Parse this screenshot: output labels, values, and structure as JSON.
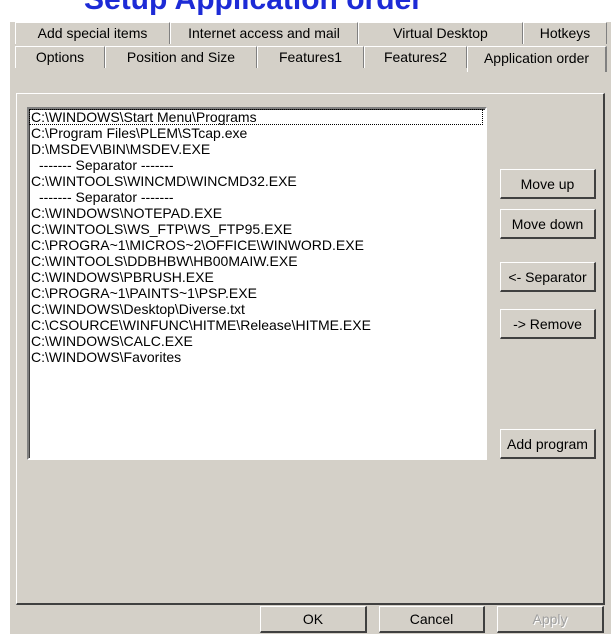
{
  "page_title": "Setup Application order",
  "tabs": {
    "row1": [
      "Add special items",
      "Internet access and mail",
      "Virtual Desktop",
      "Hotkeys"
    ],
    "row2": [
      "Options",
      "Position and Size",
      "Features1",
      "Features2",
      "Application order"
    ],
    "active": "Application order"
  },
  "list": {
    "items": [
      "C:\\WINDOWS\\Start Menu\\Programs",
      "C:\\Program Files\\PLEM\\STcap.exe",
      "D:\\MSDEV\\BIN\\MSDEV.EXE",
      "------- Separator -------",
      "C:\\WINTOOLS\\WINCMD\\WINCMD32.EXE",
      "------- Separator -------",
      "C:\\WINDOWS\\NOTEPAD.EXE",
      "C:\\WINTOOLS\\WS_FTP\\WS_FTP95.EXE",
      "C:\\PROGRA~1\\MICROS~2\\OFFICE\\WINWORD.EXE",
      "C:\\WINTOOLS\\DDBHBW\\HB00MAIW.EXE",
      "C:\\WINDOWS\\PBRUSH.EXE",
      "C:\\PROGRA~1\\PAINTS~1\\PSP.EXE",
      "C:\\WINDOWS\\Desktop\\Diverse.txt",
      "C:\\CSOURCE\\WINFUNC\\HITME\\Release\\HITME.EXE",
      "C:\\WINDOWS\\CALC.EXE",
      "C:\\WINDOWS\\Favorites"
    ]
  },
  "buttons": {
    "move_up": "Move up",
    "move_down": "Move down",
    "separator": "<- Separator",
    "remove": "-> Remove",
    "add_program": "Add program"
  },
  "dialog_buttons": {
    "ok": "OK",
    "cancel": "Cancel",
    "apply": "Apply"
  }
}
